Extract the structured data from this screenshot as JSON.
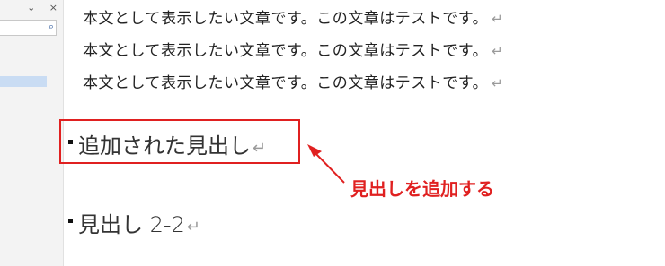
{
  "nav_pane": {
    "controls": [
      "⌄",
      "×"
    ],
    "search_icon": "search-icon"
  },
  "document": {
    "body_lines": [
      "本文として表示したい文章です。この文章はテストです。",
      "本文として表示したい文章です。この文章はテストです。",
      "本文として表示したい文章です。この文章はテストです。"
    ],
    "paragraph_mark": "↵",
    "added_heading": "追加された見出し",
    "heading_2": "見出し 2-2"
  },
  "annotation": {
    "callout_text": "見出しを追加する",
    "color": "#e02020"
  }
}
